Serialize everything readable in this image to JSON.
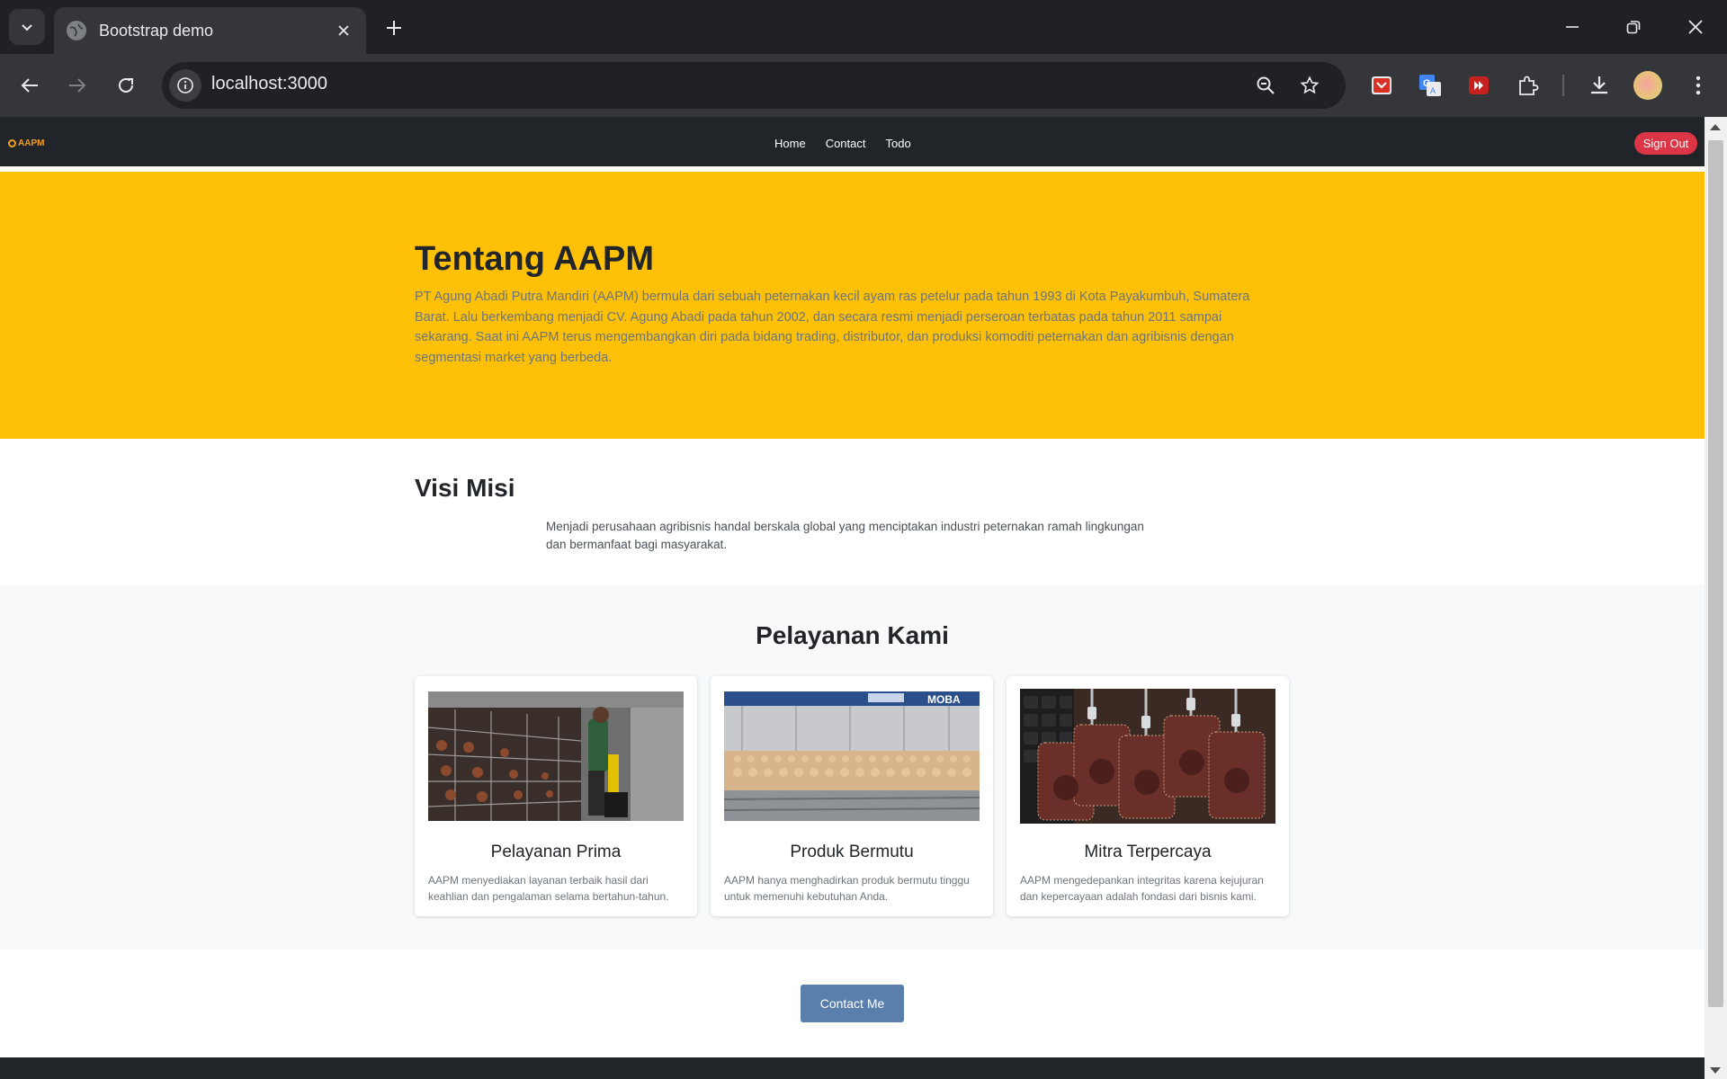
{
  "browser": {
    "tab_title": "Bootstrap demo",
    "url": "localhost:3000"
  },
  "navbar": {
    "brand": "AAPM",
    "links": [
      "Home",
      "Contact",
      "Todo"
    ],
    "signout": "Sign Out"
  },
  "hero": {
    "title": "Tentang AAPM",
    "text": "PT Agung Abadi Putra Mandiri (AAPM) bermula dari sebuah peternakan kecil ayam ras petelur pada tahun 1993 di Kota Payakumbuh, Sumatera Barat. Lalu berkembang menjadi CV. Agung Abadi pada tahun 2002, dan secara resmi menjadi perseroan terbatas pada tahun 2011 sampai sekarang. Saat ini AAPM terus mengembangkan diri pada bidang trading, distributor, dan produksi komoditi peternakan dan agribisnis dengan segmentasi market yang berbeda."
  },
  "visi": {
    "title": "Visi Misi",
    "text": "Menjadi perusahaan agribisnis handal berskala global yang menciptakan industri peternakan ramah lingkungan dan bermanfaat bagi masyarakat."
  },
  "services": {
    "title": "Pelayanan Kami",
    "cards": [
      {
        "title": "Pelayanan Prima",
        "text": "AAPM menyediakan layanan terbaik hasil dari keahlian dan pengalaman selama bertahun-tahun."
      },
      {
        "title": "Produk Bermutu",
        "text": "AAPM hanya menghadirkan produk bermutu tinggu untuk memenuhi kebutuhan Anda.",
        "image_label": "MOBA"
      },
      {
        "title": "Mitra Terpercaya",
        "text": "AAPM mengedepankan integritas karena kejujuran dan kepercayaan adalah fondasi dari bisnis kami."
      }
    ]
  },
  "contact_button": "Contact Me",
  "colors": {
    "navbar": "#212529",
    "hero": "#ffc107",
    "signout": "#dc3545",
    "contact_button": "#5b7fad"
  }
}
